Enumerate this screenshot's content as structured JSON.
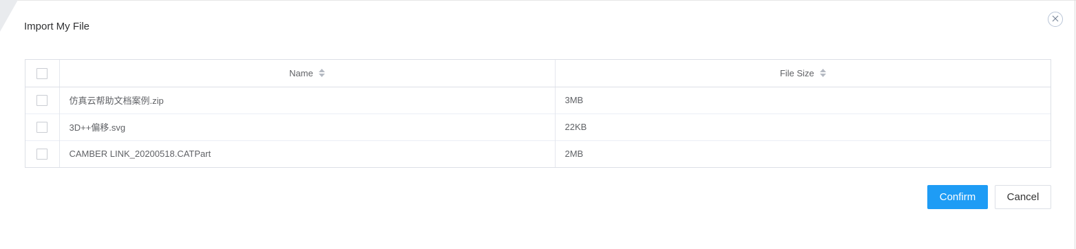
{
  "dialog": {
    "title": "Import My File",
    "close_icon": "close-icon"
  },
  "table": {
    "columns": [
      {
        "label": "Name",
        "sort_icon": "sort-icon"
      },
      {
        "label": "File Size",
        "sort_icon": "sort-icon"
      }
    ],
    "rows": [
      {
        "name": "仿真云帮助文档案例.zip",
        "size": "3MB",
        "checked": false
      },
      {
        "name": "3D++偏移.svg",
        "size": "22KB",
        "checked": false
      },
      {
        "name": "CAMBER LINK_20200518.CATPart",
        "size": "2MB",
        "checked": false
      }
    ],
    "select_all_checked": false
  },
  "footer": {
    "confirm_label": "Confirm",
    "cancel_label": "Cancel"
  },
  "colors": {
    "primary": "#1e9cf5",
    "border": "#dcdfe6",
    "text": "#606266"
  }
}
